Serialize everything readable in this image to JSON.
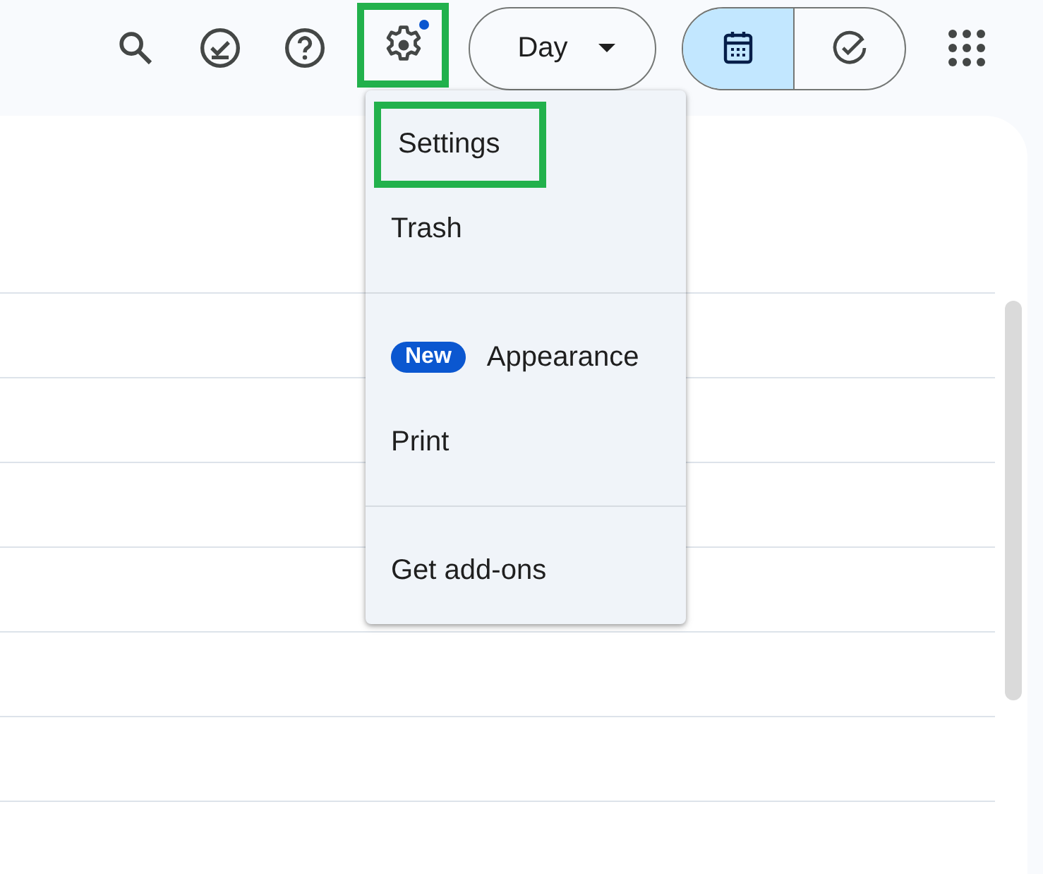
{
  "toolbar": {
    "icons": [
      {
        "kind": "search",
        "highlighted": false,
        "notification_dot": false
      },
      {
        "kind": "tasks",
        "highlighted": false,
        "notification_dot": false
      },
      {
        "kind": "help",
        "highlighted": false,
        "notification_dot": false
      },
      {
        "kind": "settings",
        "highlighted": true,
        "notification_dot": true
      }
    ],
    "view_dropdown": {
      "label": "Day"
    },
    "view_toggle": [
      {
        "kind": "calendar",
        "selected": true
      },
      {
        "kind": "tasks",
        "selected": false
      }
    ]
  },
  "settings_menu": {
    "sections": [
      [
        {
          "label": "Settings",
          "highlighted": true
        },
        {
          "label": "Trash",
          "highlighted": false
        }
      ],
      [
        {
          "label": "Appearance",
          "badge": "New",
          "highlighted": false
        },
        {
          "label": "Print",
          "highlighted": false
        }
      ],
      [
        {
          "label": "Get add-ons",
          "highlighted": false
        }
      ]
    ]
  }
}
